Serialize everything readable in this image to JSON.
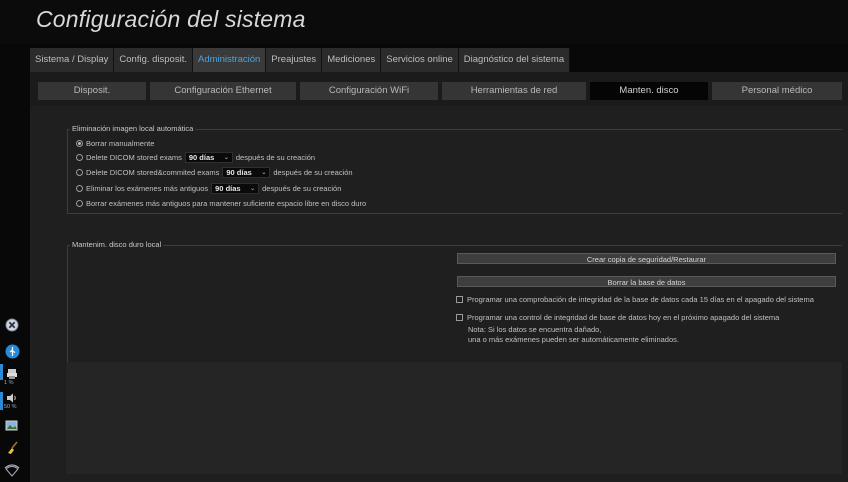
{
  "window": {
    "title": "Configuración del sistema"
  },
  "tabs": [
    {
      "label": "Sistema / Display",
      "active": false
    },
    {
      "label": "Config. disposit.",
      "active": false
    },
    {
      "label": "Administración",
      "active": true
    },
    {
      "label": "Preajustes",
      "active": false
    },
    {
      "label": "Mediciones",
      "active": false
    },
    {
      "label": "Servicios online",
      "active": false
    },
    {
      "label": "Diagnóstico del sistema",
      "active": false
    }
  ],
  "subtabs": [
    {
      "label": "Disposit.",
      "active": false
    },
    {
      "label": "Configuración Ethernet",
      "active": false
    },
    {
      "label": "Configuración WiFi",
      "active": false
    },
    {
      "label": "Herramientas de red",
      "active": false
    },
    {
      "label": "Manten. disco",
      "active": true
    },
    {
      "label": "Personal médico",
      "active": false
    }
  ],
  "auto_delete": {
    "legend": "Eliminación imagen local automática",
    "opt_manual": "Borrar manualmente",
    "opt_dicom_prefix": "Delete DICOM stored exams",
    "opt_dicom_value": "90 días",
    "opt_dicom_suffix": "después de su creación",
    "opt_commited_prefix": "Delete DICOM stored&commited exams",
    "opt_commited_value": "90 días",
    "opt_commited_suffix": "después de su creación",
    "opt_oldest_prefix": "Eliminar los exámenes más antiguos",
    "opt_oldest_value": "90 días",
    "opt_oldest_suffix": "después de su creación",
    "opt_space": "Borrar exámenes más antiguos para mantener suficiente espacio libre en disco duro",
    "selected": "manual"
  },
  "disk_maint": {
    "legend": "Mantenim. disco duro local",
    "backup_button": "Crear copia de seguridad/Restaurar",
    "erase_db_button": "Borrar la base de datos",
    "check_schedule": "Programar una comprobación de integridad de la base de datos cada 15 días en el apagado del sistema",
    "check_next": "Programar una control de integridad de base de datos hoy en el próximo apagado del sistema",
    "note_line1": "Nota: Si los datos se encuentra dañado,",
    "note_line2": "una o más exámenes pueden ser automáticamente eliminados."
  },
  "sidebar": {
    "printer_level": "1 %",
    "volume_level": "50 %",
    "icons": [
      "close-icon",
      "usb-icon",
      "printer-icon",
      "speaker-icon",
      "image-export-icon",
      "broom-icon",
      "wifi-icon"
    ]
  },
  "colors": {
    "accent": "#4aa3e0",
    "usb": "#2a8ad6"
  }
}
